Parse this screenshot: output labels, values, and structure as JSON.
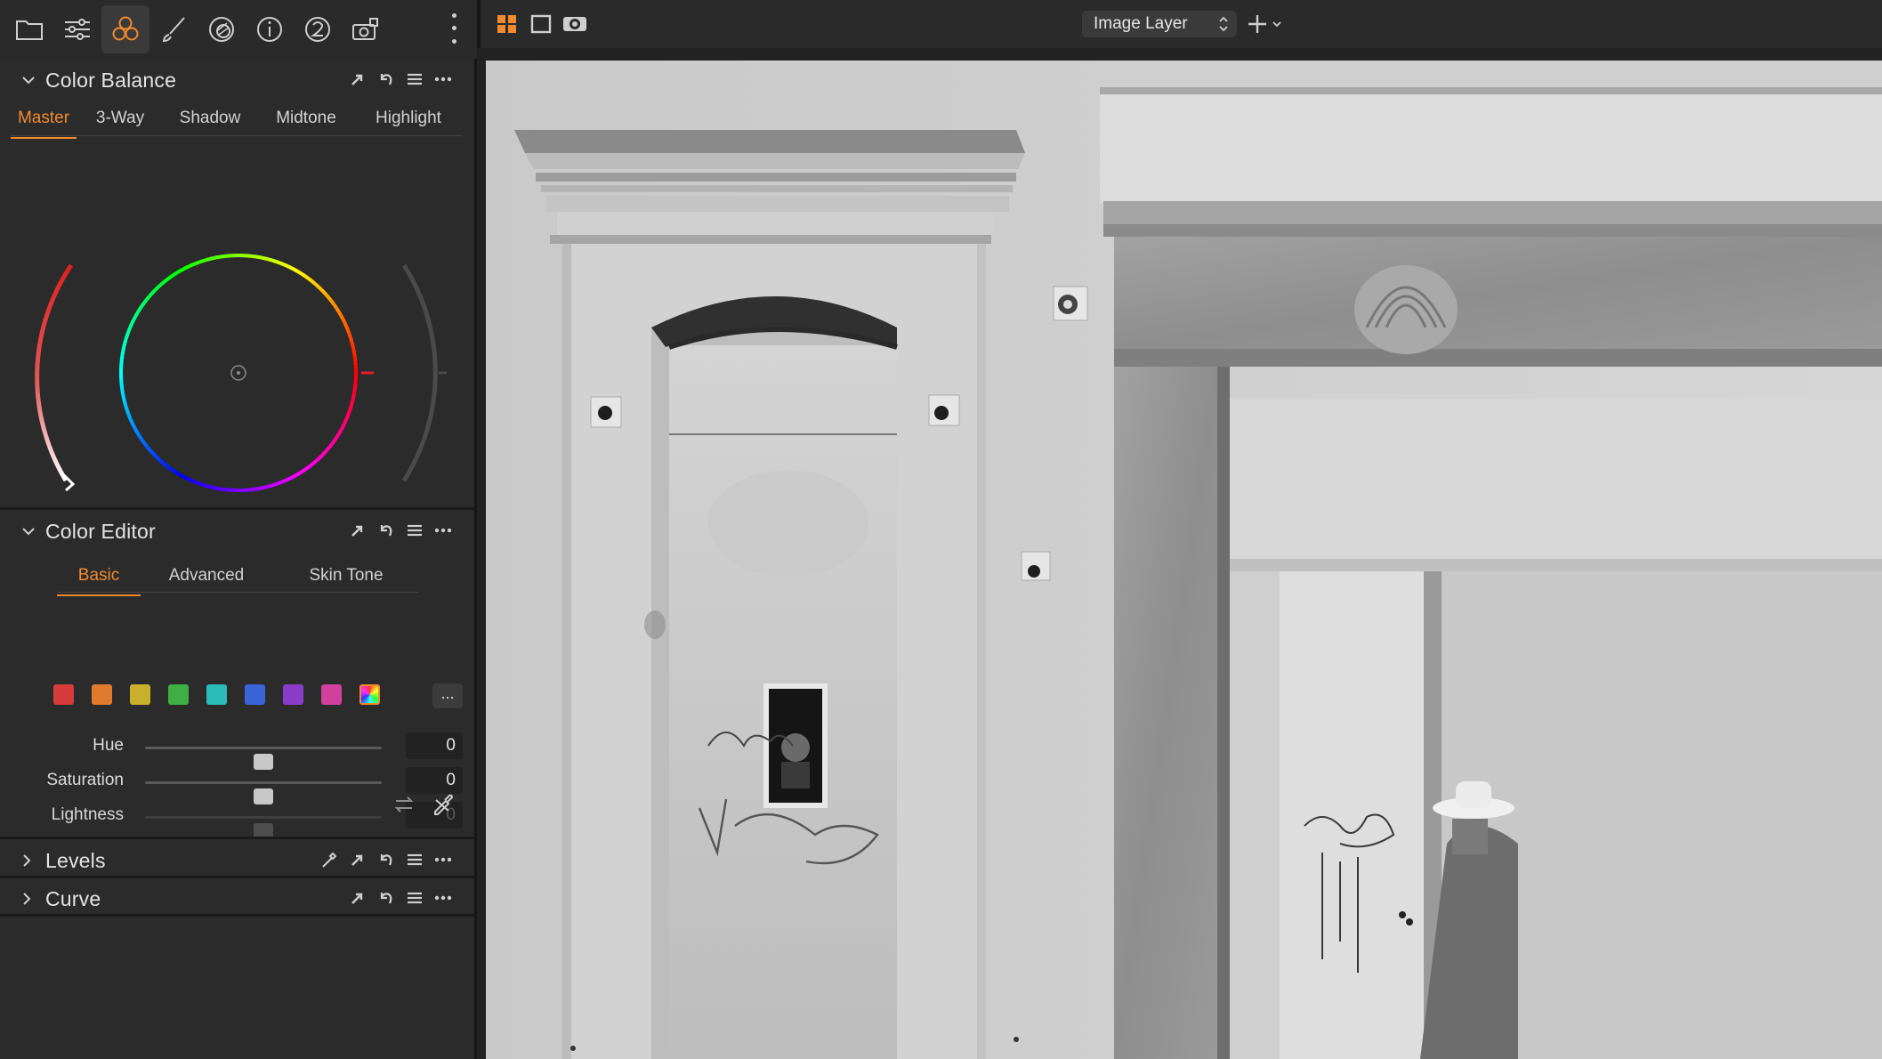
{
  "toolbar": {
    "tabs": [
      {
        "icon": "folder-icon",
        "active": false
      },
      {
        "icon": "adjustments-icon",
        "active": false
      },
      {
        "icon": "color-circles-icon",
        "active": true
      },
      {
        "icon": "brush-icon",
        "active": false
      },
      {
        "icon": "lens-icon",
        "active": false
      },
      {
        "icon": "info-icon",
        "active": false
      },
      {
        "icon": "badge-2-icon",
        "active": false
      },
      {
        "icon": "camera-icon",
        "active": false
      }
    ],
    "more_icon": "vertical-dots-icon"
  },
  "color_balance": {
    "title": "Color Balance",
    "tabs": [
      "Master",
      "3-Way",
      "Shadow",
      "Midtone",
      "Highlight"
    ],
    "active_tab": "Master"
  },
  "color_editor": {
    "title": "Color Editor",
    "tabs": [
      "Basic",
      "Advanced",
      "Skin Tone"
    ],
    "active_tab": "Basic",
    "swatches": [
      "#d63c3c",
      "#e07a2e",
      "#c9b02c",
      "#3fae45",
      "#2bbcb8",
      "#3b64d8",
      "#8a3cc9",
      "#d0409c",
      "all"
    ],
    "more_label": "...",
    "sliders": [
      {
        "label": "Hue",
        "value": "0",
        "level": 0.5,
        "disabled": false
      },
      {
        "label": "Saturation",
        "value": "0",
        "level": 0.5,
        "disabled": false
      },
      {
        "label": "Lightness",
        "value": "0",
        "level": 0.5,
        "disabled": true
      }
    ]
  },
  "levels": {
    "title": "Levels"
  },
  "curve": {
    "title": "Curve"
  },
  "viewer": {
    "layer_select": "Image Layer",
    "accent": "#f08a2c"
  }
}
